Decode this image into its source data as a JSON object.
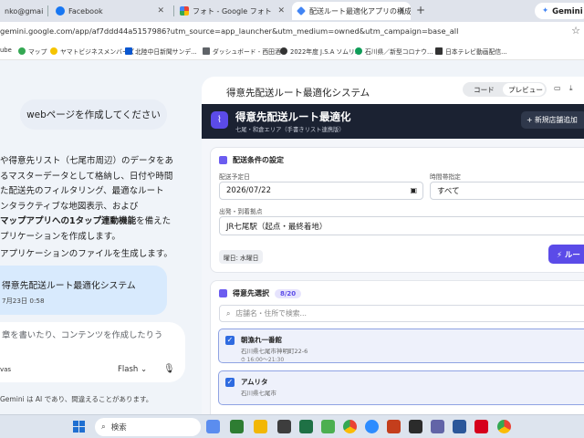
{
  "browser": {
    "tabs": [
      {
        "label": "nko@gmai",
        "color": "#ea4335"
      },
      {
        "label": "Facebook",
        "color": "#1877f2"
      },
      {
        "label": "フォト - Google フォト",
        "color": "#f4b400"
      },
      {
        "label": "配送ルート最適化アプリの構成案",
        "color": "#4285f4"
      }
    ],
    "new_tab": "+",
    "gemini_button": "Gemini に",
    "url": "gemini.google.com/app/af7ddd44a5157986?utm_source=app_launcher&utm_medium=owned&utm_campaign=base_all",
    "star": "☆",
    "bookmarks": [
      {
        "label": "ube",
        "color": "#ff0000"
      },
      {
        "label": "マップ",
        "color": "#34a853"
      },
      {
        "label": "ヤマトビジネスメンバーズ",
        "color": "#222222"
      },
      {
        "label": "北陸中日新聞サンデ...",
        "color": "#0b57d0"
      },
      {
        "label": "ダッシュボード - 西田酒...",
        "color": "#5f6368"
      },
      {
        "label": "2022年度 J.S.A ソムリ...",
        "color": "#333333"
      },
      {
        "label": "石川県／新型コロナウ...",
        "color": "#0f9d58"
      },
      {
        "label": "日本テレビ動画配信...",
        "color": "#333333"
      }
    ]
  },
  "chat": {
    "user_message": "webページを作成してください",
    "response_lines": [
      "や得意先リスト（七尾市周辺）のデータをあ",
      "るマスターデータとして格納し、日付や時間",
      "た配送先のフィルタリング、最適なルート",
      "ンタラクティブな地図表示、および"
    ],
    "response_bold": "マップアプリへの1タップ連動機能",
    "response_after_bold": "を備えた",
    "response_last": "プリケーションを作成します。",
    "response_2": "アプリケーションのファイルを生成します。",
    "file_card": {
      "title": "得意先配送ルート最適化システム",
      "date": "7月23日 0:58"
    },
    "prompt_placeholder": "章を書いたり、コンテンツを作成したりう",
    "canvas_chip": "vas",
    "model": "Flash",
    "model_caret": "⌄",
    "mic_icon": "🎙",
    "disclaimer": "Gemini は AI であり、間違えることがあります。"
  },
  "canvas": {
    "title": "得意先配送ルート最適化システム",
    "code_label": "コード",
    "preview_label": "プレビュー",
    "app": {
      "title": "得意先配送ルート最適化",
      "subtitle": "七尾・和倉エリア（手書きリスト連携版）",
      "add_button": "+ 新規店舗追加",
      "conditions_title": "配送条件の設定",
      "date_label": "配送予定日",
      "date_value": "2026/07/22",
      "time_label": "時間帯指定",
      "time_value": "すべて",
      "origin_label": "出発・到着拠点",
      "origin_value": "JR七尾駅（起点・最終着地）",
      "weekday": "曜日: 水曜日",
      "route_button": "⚡ ルー",
      "customers_title": "得意先選択",
      "customers_count": "8/20",
      "search_placeholder": "店舗名・住所で検索...",
      "shops": [
        {
          "name": "朝漁れ一番館",
          "address": "石川県七尾市神明町22-6",
          "time": "⏱ 16:00〜21:30"
        },
        {
          "name": "アムリタ",
          "address": "石川県七尾市",
          "time": ""
        }
      ]
    }
  },
  "taskbar": {
    "search": "検索"
  }
}
